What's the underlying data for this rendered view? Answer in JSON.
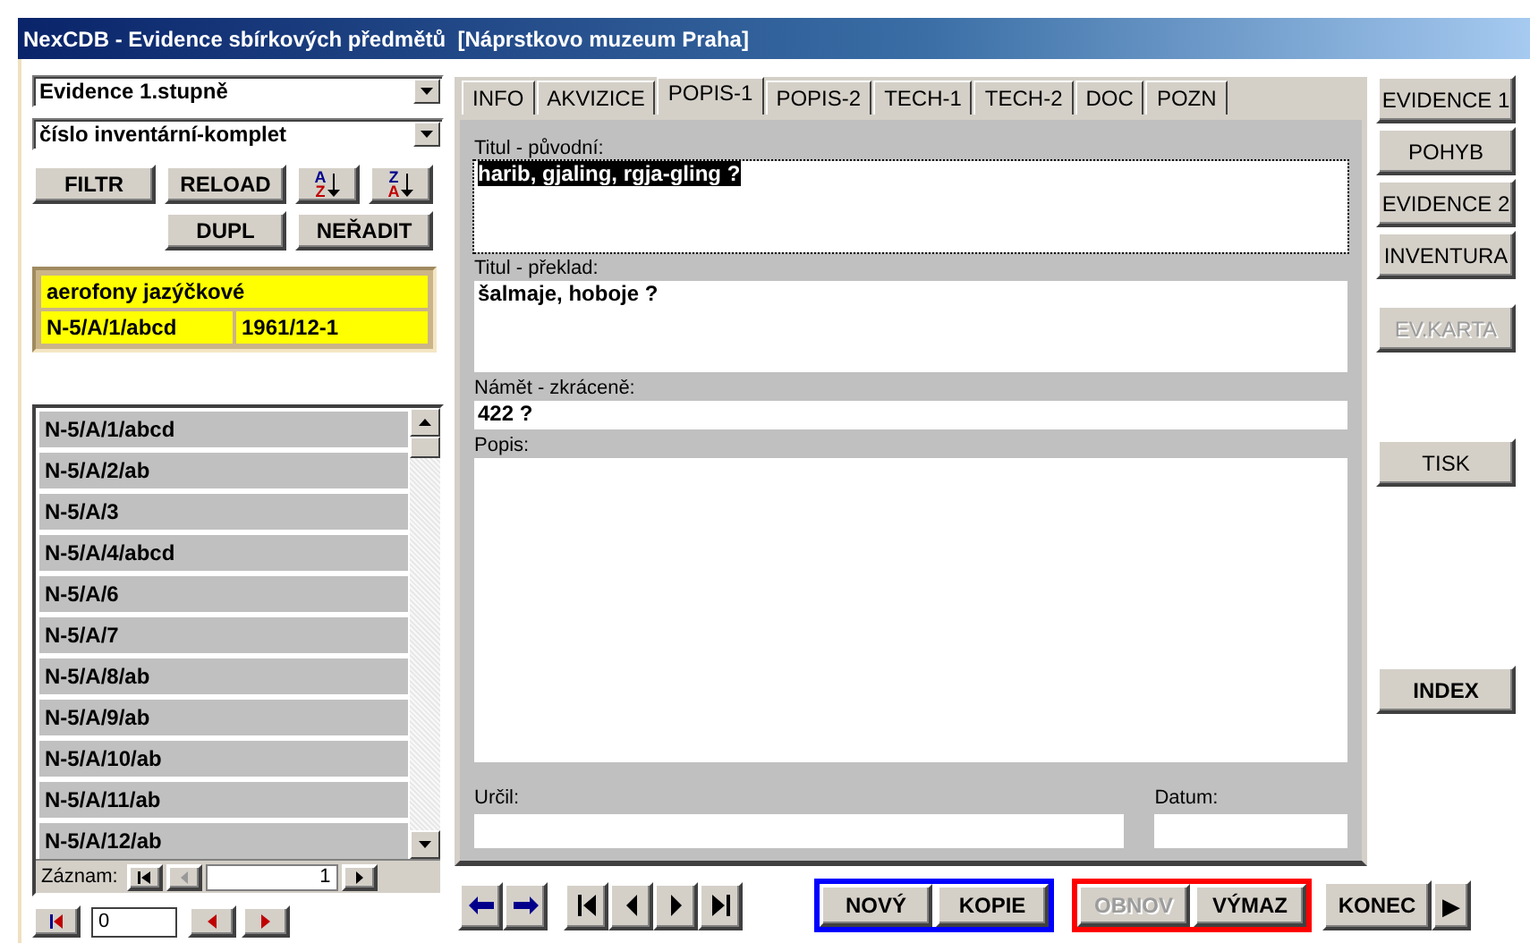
{
  "window": {
    "title": "NexCDB - Evidence sbírkových předmětů  [Náprstkovo muzeum Praha]"
  },
  "left_panel": {
    "selects": [
      {
        "value": "Evidence 1.stupně"
      },
      {
        "value": "číslo inventární-komplet"
      }
    ],
    "buttons": [
      {
        "kind": "text",
        "label": "FILTR"
      },
      {
        "kind": "text",
        "label": "RELOAD"
      },
      {
        "kind": "sort",
        "top": "A",
        "bottom": "Z"
      },
      {
        "kind": "sort",
        "top": "Z",
        "bottom": "A"
      },
      {
        "kind": "text",
        "label": "DUPL"
      },
      {
        "kind": "text",
        "label": "NEŘADIT"
      }
    ],
    "record": {
      "category": "aerofony jazýčkové",
      "inventory_number": "N-5/A/1/abcd",
      "accession": "1961/12-1"
    },
    "list": [
      {
        "label": "N-5/A/1/abcd"
      },
      {
        "label": "N-5/A/2/ab"
      },
      {
        "label": "N-5/A/3"
      },
      {
        "label": "N-5/A/4/abcd"
      },
      {
        "label": "N-5/A/6"
      },
      {
        "label": "N-5/A/7"
      },
      {
        "label": "N-5/A/8/ab"
      },
      {
        "label": "N-5/A/9/ab"
      },
      {
        "label": "N-5/A/10/ab"
      },
      {
        "label": "N-5/A/11/ab"
      },
      {
        "label": "N-5/A/12/ab"
      }
    ],
    "record_nav": {
      "label": "Záznam:",
      "value": "1"
    },
    "jump_field": {
      "value": "0"
    }
  },
  "tabs": [
    {
      "label": "INFO",
      "selected": false
    },
    {
      "label": "AKVIZICE",
      "selected": false
    },
    {
      "label": "POPIS-1",
      "selected": true
    },
    {
      "label": "POPIS-2",
      "selected": false
    },
    {
      "label": "TECH-1",
      "selected": false
    },
    {
      "label": "TECH-2",
      "selected": false
    },
    {
      "label": "DOC",
      "selected": false
    },
    {
      "label": "POZN",
      "selected": false
    }
  ],
  "fields": [
    {
      "label": "Titul - původní:",
      "value": "harib, gjaling, rgja-gling ?",
      "kind": "multiline",
      "selected": true
    },
    {
      "label": "Titul - překlad:",
      "value": "šalmaje, hoboje ?",
      "kind": "multiline",
      "selected": false
    },
    {
      "label": "Námět - zkráceně:",
      "value": "422 ?",
      "kind": "singleline",
      "selected": false
    },
    {
      "label": "Popis:",
      "kind": "area",
      "selected": false
    }
  ],
  "footer_fields": [
    {
      "label": "Určil:"
    },
    {
      "label": "Datum:"
    }
  ],
  "side_buttons": [
    [
      {
        "label": "EVIDENCE 1",
        "disabled": false,
        "bold": false
      },
      {
        "label": "POHYB",
        "disabled": false,
        "bold": false
      },
      {
        "label": "EVIDENCE 2",
        "disabled": false,
        "bold": false
      },
      {
        "label": "INVENTURA",
        "disabled": false,
        "bold": false
      }
    ],
    [
      {
        "label": "EV.KARTA",
        "disabled": true,
        "bold": false
      }
    ],
    [
      {
        "label": "TISK",
        "disabled": false,
        "bold": false
      }
    ],
    [
      {
        "label": "INDEX",
        "disabled": false,
        "bold": true
      }
    ]
  ],
  "toolbar": {
    "groups": [
      {
        "color": "#0000ff",
        "buttons": [
          {
            "label": "NOVÝ",
            "disabled": false
          },
          {
            "label": "KOPIE",
            "disabled": false
          }
        ]
      },
      {
        "color": "#ff0000",
        "buttons": [
          {
            "label": "OBNOV",
            "disabled": true
          },
          {
            "label": "VÝMAZ",
            "disabled": false
          }
        ]
      }
    ],
    "exit": {
      "label": "KONEC"
    },
    "more": {
      "label": "▶"
    }
  }
}
